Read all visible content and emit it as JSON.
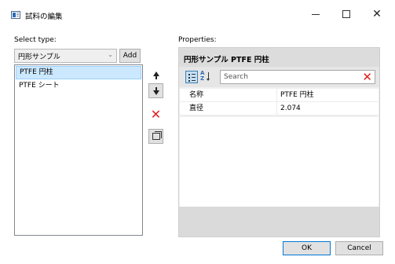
{
  "window": {
    "title": "試料の編集",
    "minimize_icon": "minimize-icon",
    "maximize_icon": "maximize-icon",
    "close_icon": "close-icon"
  },
  "left": {
    "select_type_label": "Select type:",
    "combo_value": "円形サンプル",
    "add_label": "Add",
    "types": [
      {
        "label": "PTFE 円柱",
        "selected": true
      },
      {
        "label": "PTFE シート",
        "selected": false
      }
    ]
  },
  "side_buttons": {
    "up_icon": "arrow-up-icon",
    "down_icon": "arrow-down-icon",
    "delete_icon": "delete-x-icon",
    "copy_icon": "copy-icon"
  },
  "properties": {
    "label": "Properties:",
    "header_title": "円形サンプル  PTFE 円柱",
    "search_placeholder": "Search",
    "rows": [
      {
        "name": "名称",
        "value": "PTFE 円柱"
      },
      {
        "name": "直径",
        "value": "2.074"
      }
    ]
  },
  "footer": {
    "ok_label": "OK",
    "cancel_label": "Cancel"
  },
  "colors": {
    "selection": "#cce8ff",
    "delete_red": "#e02020",
    "ok_border": "#0078d7"
  }
}
